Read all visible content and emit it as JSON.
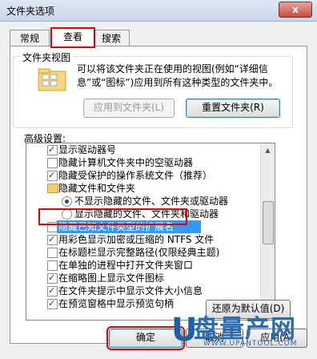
{
  "window": {
    "title": "文件夹选项",
    "close": "x"
  },
  "tabs": [
    {
      "label": "常规"
    },
    {
      "label": "查看"
    },
    {
      "label": "搜索"
    }
  ],
  "folder_views": {
    "group_label": "文件夹视图",
    "description": "可以将该文件夹正在使用的视图(例如“详细信息”或“图标”)应用到所有这种类型的文件夹中。",
    "apply_label": "应用到文件夹(L)",
    "reset_label": "重置文件夹(R)"
  },
  "advanced": {
    "label": "高级设置:",
    "items": [
      {
        "type": "checkbox",
        "checked": true,
        "text": "显示驱动器号"
      },
      {
        "type": "checkbox",
        "checked": false,
        "text": "隐藏计算机文件夹中的空驱动器"
      },
      {
        "type": "checkbox",
        "checked": true,
        "text": "隐藏受保护的操作系统文件（推荐）"
      },
      {
        "type": "folder",
        "text": "隐藏文件和文件夹"
      },
      {
        "type": "radio",
        "checked": true,
        "text": "不显示隐藏的文件、文件夹或驱动器"
      },
      {
        "type": "radio",
        "checked": false,
        "text": "显示隐藏的文件、文件夹和驱动器"
      },
      {
        "type": "checkbox",
        "checked": false,
        "text": "隐藏已知文件类型的扩展名",
        "selected": true
      },
      {
        "type": "checkbox",
        "checked": true,
        "text": "用彩色显示加密或压缩的 NTFS 文件"
      },
      {
        "type": "checkbox",
        "checked": false,
        "text": "在标题栏显示完整路径(仅限经典主题)"
      },
      {
        "type": "checkbox",
        "checked": false,
        "text": "在单独的进程中打开文件夹窗口"
      },
      {
        "type": "checkbox",
        "checked": true,
        "text": "在缩略图上显示文件图标"
      },
      {
        "type": "checkbox",
        "checked": true,
        "text": "在文件夹提示中显示文件大小信息"
      },
      {
        "type": "checkbox",
        "checked": true,
        "text": "在预览窗格中显示预览句柄"
      }
    ],
    "restore_label": "还原为默认值(D)"
  },
  "footer": {
    "ok": "确定",
    "cancel": "取消",
    "apply": "应用(A)"
  },
  "watermark": {
    "big": "盘量产网",
    "small": "WWW.UPANTOOL.COM",
    "u": "U"
  }
}
